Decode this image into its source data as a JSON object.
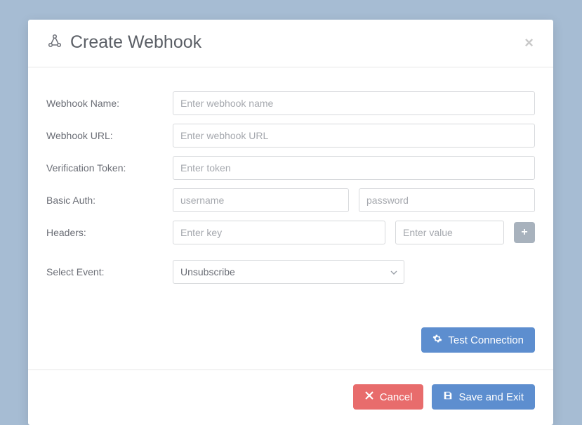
{
  "header": {
    "title": "Create Webhook"
  },
  "form": {
    "name": {
      "label": "Webhook Name:",
      "placeholder": "Enter webhook name",
      "value": ""
    },
    "url": {
      "label": "Webhook URL:",
      "placeholder": "Enter webhook URL",
      "value": ""
    },
    "token": {
      "label": "Verification Token:",
      "placeholder": "Enter token",
      "value": ""
    },
    "basicAuth": {
      "label": "Basic Auth:",
      "username": {
        "placeholder": "username",
        "value": ""
      },
      "password": {
        "placeholder": "password",
        "value": ""
      }
    },
    "headers": {
      "label": "Headers:",
      "key": {
        "placeholder": "Enter key",
        "value": ""
      },
      "value": {
        "placeholder": "Enter value",
        "value": ""
      }
    },
    "event": {
      "label": "Select Event:",
      "selected": "Unsubscribe"
    }
  },
  "buttons": {
    "test": "Test Connection",
    "cancel": "Cancel",
    "save": "Save and Exit"
  }
}
